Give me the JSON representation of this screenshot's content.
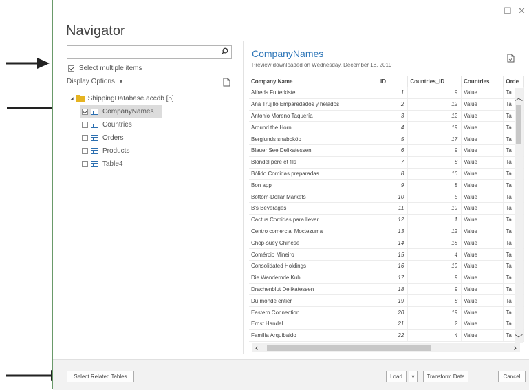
{
  "window": {
    "title": "Navigator",
    "restore_glyph": "☐",
    "close_glyph": "✕"
  },
  "left_pane": {
    "search": {
      "value": "",
      "placeholder": ""
    },
    "select_multiple": {
      "label": "Select multiple items",
      "checked": true
    },
    "display_options": {
      "label": "Display Options",
      "caret": "▼"
    },
    "tree": {
      "root": {
        "label": "ShippingDatabase.accdb [5]",
        "expanded": true
      },
      "items": [
        {
          "label": "CompanyNames",
          "checked": true,
          "selected": true
        },
        {
          "label": "Countries",
          "checked": false,
          "selected": false
        },
        {
          "label": "Orders",
          "checked": false,
          "selected": false
        },
        {
          "label": "Products",
          "checked": false,
          "selected": false
        },
        {
          "label": "Table4",
          "checked": false,
          "selected": false
        }
      ]
    }
  },
  "preview": {
    "title": "CompanyNames",
    "subtitle": "Preview downloaded on Wednesday, December 18, 2019",
    "columns": [
      "Company Name",
      "ID",
      "Countries_ID",
      "Countries",
      "Orde"
    ],
    "rows": [
      [
        "Alfreds Futterkiste",
        "1",
        "9",
        "Value",
        "Ta"
      ],
      [
        "Ana Trujillo Emparedados y helados",
        "2",
        "12",
        "Value",
        "Ta"
      ],
      [
        "Antonio Moreno Taquería",
        "3",
        "12",
        "Value",
        "Ta"
      ],
      [
        "Around the Horn",
        "4",
        "19",
        "Value",
        "Ta"
      ],
      [
        "Berglunds snabbköp",
        "5",
        "17",
        "Value",
        "Ta"
      ],
      [
        "Blauer See Delikatessen",
        "6",
        "9",
        "Value",
        "Ta"
      ],
      [
        "Blondel père et fils",
        "7",
        "8",
        "Value",
        "Ta"
      ],
      [
        "Bólido Comidas preparadas",
        "8",
        "16",
        "Value",
        "Ta"
      ],
      [
        "Bon app'",
        "9",
        "8",
        "Value",
        "Ta"
      ],
      [
        "Bottom-Dollar Markets",
        "10",
        "5",
        "Value",
        "Ta"
      ],
      [
        "B's Beverages",
        "11",
        "19",
        "Value",
        "Ta"
      ],
      [
        "Cactus Comidas para llevar",
        "12",
        "1",
        "Value",
        "Ta"
      ],
      [
        "Centro comercial Moctezuma",
        "13",
        "12",
        "Value",
        "Ta"
      ],
      [
        "Chop-suey Chinese",
        "14",
        "18",
        "Value",
        "Ta"
      ],
      [
        "Comércio Mineiro",
        "15",
        "4",
        "Value",
        "Ta"
      ],
      [
        "Consolidated Holdings",
        "16",
        "19",
        "Value",
        "Ta"
      ],
      [
        "Die Wandernde Kuh",
        "17",
        "9",
        "Value",
        "Ta"
      ],
      [
        "Drachenblut Delikatessen",
        "18",
        "9",
        "Value",
        "Ta"
      ],
      [
        "Du monde entier",
        "19",
        "8",
        "Value",
        "Ta"
      ],
      [
        "Eastern Connection",
        "20",
        "19",
        "Value",
        "Ta"
      ],
      [
        "Ernst Handel",
        "21",
        "2",
        "Value",
        "Ta"
      ],
      [
        "Familia Arquibaldo",
        "22",
        "4",
        "Value",
        "Ta"
      ]
    ]
  },
  "footer": {
    "select_related": "Select Related Tables",
    "load": "Load",
    "load_caret": "▾",
    "transform": "Transform Data",
    "cancel": "Cancel"
  },
  "colors": {
    "accent": "#2e76b8",
    "folder": "#e6b422",
    "window_border": "#6a9a6a"
  }
}
